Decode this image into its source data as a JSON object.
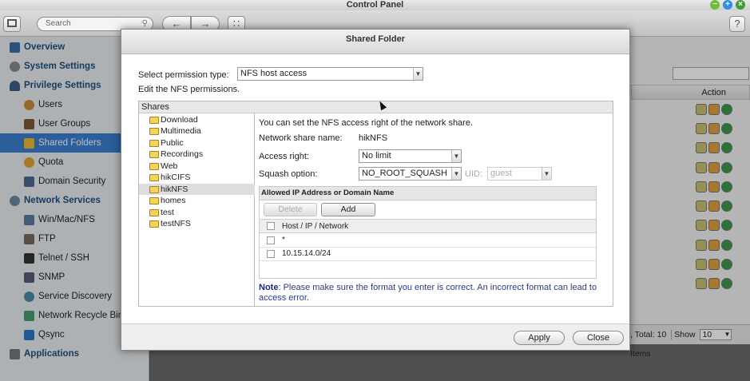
{
  "window": {
    "title": "Control Panel"
  },
  "toolbar": {
    "search_placeholder": "Search",
    "back_icon": "←",
    "forward_icon": "→",
    "grid_icon": "∷",
    "help_label": "?"
  },
  "sidebar": {
    "items": [
      {
        "label": "Overview"
      },
      {
        "label": "System Settings"
      },
      {
        "label": "Privilege Settings"
      },
      {
        "label": "Users"
      },
      {
        "label": "User Groups"
      },
      {
        "label": "Shared Folders"
      },
      {
        "label": "Quota"
      },
      {
        "label": "Domain Security"
      },
      {
        "label": "Network Services"
      },
      {
        "label": "Win/Mac/NFS"
      },
      {
        "label": "FTP"
      },
      {
        "label": "Telnet / SSH"
      },
      {
        "label": "SNMP"
      },
      {
        "label": "Service Discovery"
      },
      {
        "label": "Network Recycle Bin"
      },
      {
        "label": "Qsync"
      },
      {
        "label": "Applications"
      }
    ]
  },
  "background": {
    "action_header": "Action",
    "pager": {
      "total": ", Total: 10",
      "show": "Show",
      "per_page": "10",
      "items": "Items"
    }
  },
  "dialog": {
    "title": "Shared Folder",
    "permission_label": "Select permission type:",
    "permission_value": "NFS host access",
    "edit_text": "Edit the NFS permissions.",
    "shares_header": "Shares",
    "folders": [
      "Download",
      "Multimedia",
      "Public",
      "Recordings",
      "Web",
      "hikCIFS",
      "hikNFS",
      "homes",
      "test",
      "testNFS"
    ],
    "intro": "You can set the NFS access right of the network share.",
    "share_name_label": "Network share name:",
    "share_name_value": "hikNFS",
    "access_label": "Access right:",
    "access_value": "No limit",
    "squash_label": "Squash option:",
    "squash_value": "NO_ROOT_SQUASH",
    "uid_label": "UID:",
    "uid_value": "guest",
    "allowed_header": "Allowed IP Address or Domain Name",
    "delete_label": "Delete",
    "add_label": "Add",
    "col_host": "Host / IP / Network",
    "hosts": [
      "*",
      "10.15.14.0/24"
    ],
    "note_bold": "Note",
    "note_text": ": Please make sure the format you enter is correct. An incorrect format can lead to access error.",
    "apply_label": "Apply",
    "close_label": "Close"
  }
}
